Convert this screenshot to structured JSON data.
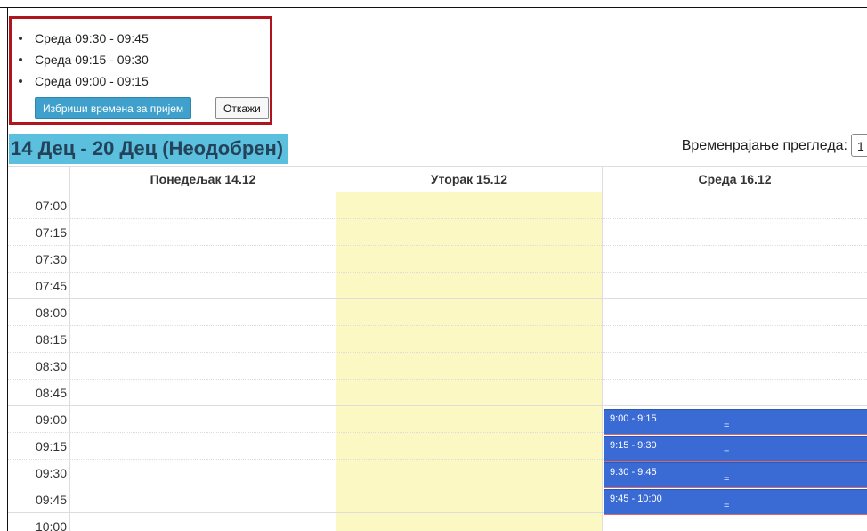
{
  "selection": {
    "items": [
      "Среда 09:30 - 09:45",
      "Среда 09:15 - 09:30",
      "Среда 09:00 - 09:15"
    ],
    "delete_button": "Избриши времена за пријем",
    "cancel_button": "Откажи"
  },
  "header": {
    "week_title": "14 Дец - 20 Дец (Неодобрен)",
    "duration_label": "Временрајање прегледа:",
    "duration_value": "1"
  },
  "calendar": {
    "days": [
      "Понедељак 14.12",
      "Уторак 15.12",
      "Среда 16.12"
    ],
    "times": [
      "07:00",
      "07:15",
      "07:30",
      "07:45",
      "08:00",
      "08:15",
      "08:30",
      "08:45",
      "09:00",
      "09:15",
      "09:30",
      "09:45",
      "10:00"
    ],
    "events": [
      {
        "label": "9:00 - 9:15",
        "handle": "="
      },
      {
        "label": "9:15 - 9:30",
        "handle": "="
      },
      {
        "label": "9:30 - 9:45",
        "handle": "="
      },
      {
        "label": "9:45 - 10:00",
        "handle": "="
      }
    ],
    "highlight_color": "#fcf8c4",
    "event_color": "#3a6ad4"
  }
}
